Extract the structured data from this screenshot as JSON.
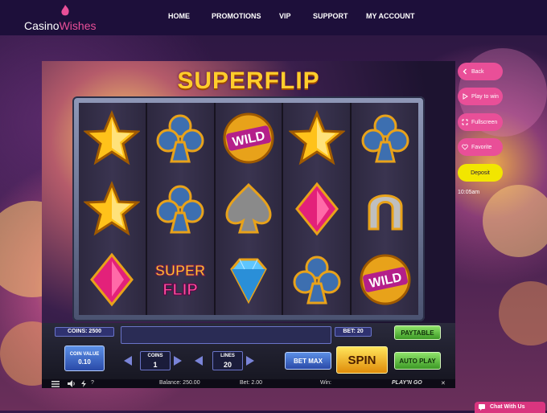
{
  "brand": {
    "part1": "Casino",
    "part2": "Wishes"
  },
  "nav": [
    "HOME",
    "PROMOTIONS",
    "VIP",
    "SUPPORT",
    "MY ACCOUNT"
  ],
  "game": {
    "title": "SUPERFLIP",
    "reels": [
      [
        "star-icon",
        "star-icon",
        "diamond-icon"
      ],
      [
        "club-icon",
        "club-icon",
        "superflip-icon"
      ],
      [
        "wild-icon",
        "spade-icon",
        "gem-icon"
      ],
      [
        "star-icon",
        "diamond-icon",
        "club-icon"
      ],
      [
        "club-icon",
        "horseshoe-icon",
        "wild-icon"
      ]
    ],
    "superflip_symbol": {
      "top": "SUPER",
      "bottom": "FLIP"
    },
    "wild_text": "WILD",
    "coins_label": "COINS: 2500",
    "bet_label": "BET: 20",
    "paytable": "PAYTABLE",
    "coin_value_label": "COIN VALUE",
    "coin_value": "0.10",
    "coins_title": "COINS",
    "coins_value": "1",
    "lines_title": "LINES",
    "lines_value": "20",
    "bet_max": "BET MAX",
    "spin": "SPIN",
    "auto_play": "AUTO PLAY",
    "provider": "PLAY'N GO",
    "balance": "Balance: 250.00",
    "bet": "Bet: 2.00",
    "win": "Win:",
    "close": "✕",
    "help": "?"
  },
  "side": {
    "back": "Back",
    "play": "Play to win",
    "fullscreen": "Fullscreen",
    "favorite": "Favorite",
    "deposit": "Deposit",
    "time": "10:05am"
  },
  "chat": "Chat With Us",
  "colors": {
    "accent": "#e94f98",
    "topbar": "#1d0f3a",
    "deposit": "#f2e600"
  }
}
